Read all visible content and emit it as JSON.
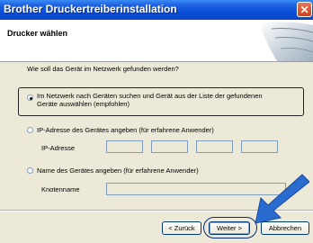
{
  "window": {
    "title": "Brother Druckertreiberinstallation",
    "close_glyph": "✕"
  },
  "header": {
    "title": "Drucker wählen",
    "logo_icon": "brother-printer-graphic"
  },
  "question": "Wie soll das Gerät im Netzwerk gefunden werden?",
  "options": {
    "search": {
      "label_line1": "Im Netzwerk nach Geräten suchen und Gerät aus der Liste der gefundenen",
      "label_line2": "Geräte auswählen (empfohlen)",
      "selected": true
    },
    "ip": {
      "label": "IP-Adresse des Gerätes angeben (für erfahrene Anwender)",
      "field_label": "IP-Adresse",
      "selected": false
    },
    "name": {
      "label": "Name des Gerätes angeben (für erfahrene Anwender)",
      "field_label": "Knotenname",
      "selected": false
    }
  },
  "buttons": {
    "back": "< Zurück",
    "next": "Weiter >",
    "cancel": "Abbrechen"
  },
  "annotation": {
    "arrow_icon": "blue-arrow-pointer",
    "arrow_color": "#2a6bd0"
  }
}
